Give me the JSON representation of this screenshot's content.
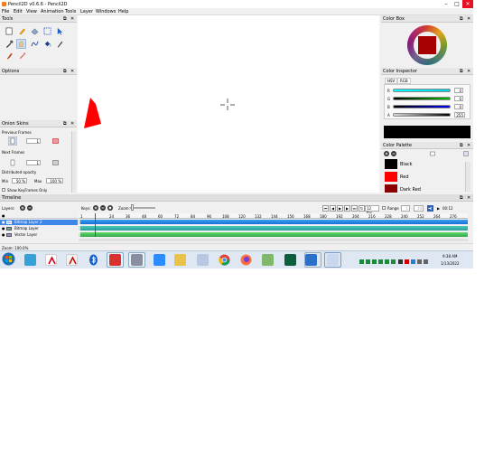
{
  "window": {
    "title": "Pencil2D v0.6.6 - Pencil2D",
    "min": "–",
    "max": "□",
    "close": "✕"
  },
  "menu": [
    "File",
    "Edit",
    "View",
    "Animation",
    "Tools",
    "Layer",
    "Windows",
    "Help"
  ],
  "tools_panel": {
    "title": "Tools"
  },
  "options_panel": {
    "title": "Options"
  },
  "onion_panel": {
    "title": "Onion Skins",
    "previous_frames": "Previous Frames",
    "prev_value": "1",
    "next_frames": "Next Frames",
    "next_value": "1",
    "distributed_opacity": "Distributed opacity",
    "min_label": "Min",
    "min_value": "50 %",
    "max_label": "Max",
    "max_value": "100 %",
    "keyframes_only": "Show KeyFrames Only"
  },
  "color_box": {
    "title": "Color Box"
  },
  "color_inspector": {
    "title": "Color Inspector",
    "tabs": [
      "HSV",
      "RGB"
    ],
    "channels": [
      {
        "label": "R",
        "value": "0",
        "color": "#00d7e8"
      },
      {
        "label": "G",
        "value": "0",
        "color": "#00b000"
      },
      {
        "label": "B",
        "value": "0",
        "color": "#0000e0"
      },
      {
        "label": "A",
        "value": "255",
        "color": "#000000"
      }
    ],
    "current_color": "#000000"
  },
  "color_palette": {
    "title": "Color Palette",
    "colors": [
      {
        "name": "Black",
        "hex": "#000000"
      },
      {
        "name": "Red",
        "hex": "#ff0000"
      },
      {
        "name": "Dark Red",
        "hex": "#8b0000"
      }
    ]
  },
  "timeline": {
    "title": "Timeline",
    "layers_label": "Layers:",
    "keys_label": "Keys:",
    "zoom_label": "Zoom:",
    "fps": "12 fps",
    "range_label": "Range",
    "range_start": "1",
    "range_end": "10",
    "current_frame": "00:12",
    "frame_numbers": [
      "1",
      "24",
      "36",
      "48",
      "60",
      "72",
      "84",
      "96",
      "108",
      "120",
      "132",
      "144",
      "156",
      "168",
      "180",
      "192",
      "204",
      "216",
      "228",
      "240",
      "252",
      "264",
      "276"
    ],
    "layers": [
      {
        "name": "Bitmap Layer 2",
        "selected": true
      },
      {
        "name": "Bitmap Layer",
        "selected": false
      },
      {
        "name": "Vector Layer",
        "selected": false
      }
    ]
  },
  "status": {
    "zoom": "Zoom: 100.0%"
  },
  "taskbar": {
    "time": "9:38 AM",
    "date": "1/13/2022"
  }
}
